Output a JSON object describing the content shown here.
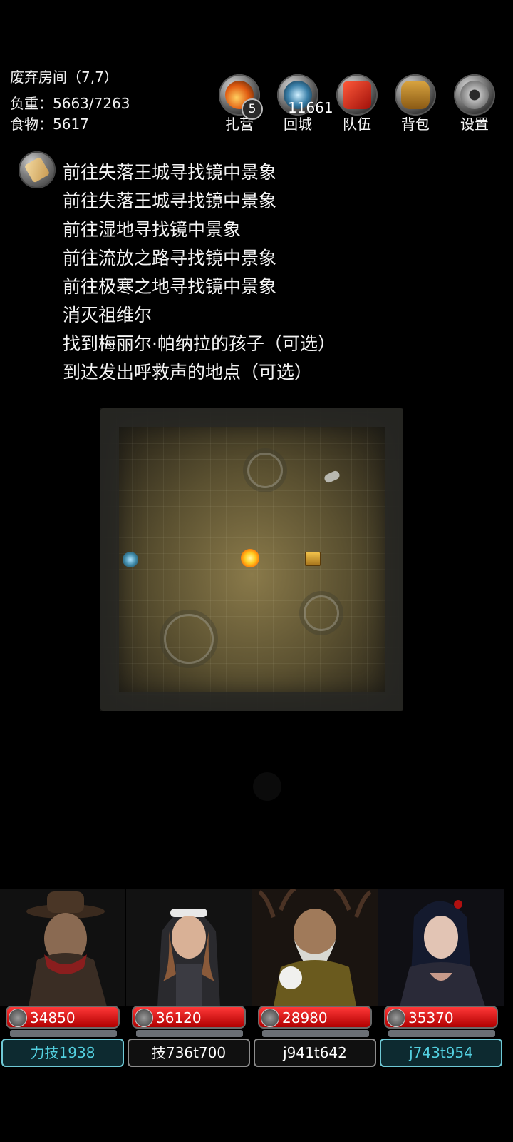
{
  "location": {
    "room": "废弃房间（7,7）",
    "load": "负重：5663/7263",
    "food": "食物：5617"
  },
  "toolbar": {
    "camp": {
      "label": "扎营",
      "badge": "5",
      "icon": "campfire-icon"
    },
    "return": {
      "label": "回城",
      "icon": "portal-icon"
    },
    "gold_count": "11661",
    "team": {
      "label": "队伍",
      "icon": "team-banner-icon"
    },
    "bag": {
      "label": "背包",
      "icon": "barrel-icon"
    },
    "settings": {
      "label": "设置",
      "icon": "gear-icon"
    }
  },
  "quests": [
    "前往失落王城寻找镜中景象",
    "前往失落王城寻找镜中景象",
    "前往湿地寻找镜中景象",
    "前往流放之路寻找镜中景象",
    "前往极寒之地寻找镜中景象",
    "消灭祖维尔",
    "找到梅丽尔·帕纳拉的孩子（可选）",
    "到达发出呼救声的地点（可选）"
  ],
  "party": [
    {
      "hp": "34850",
      "name": "力技1938",
      "highlight": true,
      "portrait": "cowboy-hero"
    },
    {
      "hp": "36120",
      "name": "技736t700",
      "highlight": false,
      "portrait": "nun-hero"
    },
    {
      "hp": "28980",
      "name": "j941t642",
      "highlight": false,
      "portrait": "druid-hero"
    },
    {
      "hp": "35370",
      "name": "j743t954",
      "highlight": true,
      "portrait": "warrior-woman-hero"
    }
  ],
  "colors": {
    "hp_red": "#d41414",
    "highlight_cyan": "#53d0e0"
  }
}
